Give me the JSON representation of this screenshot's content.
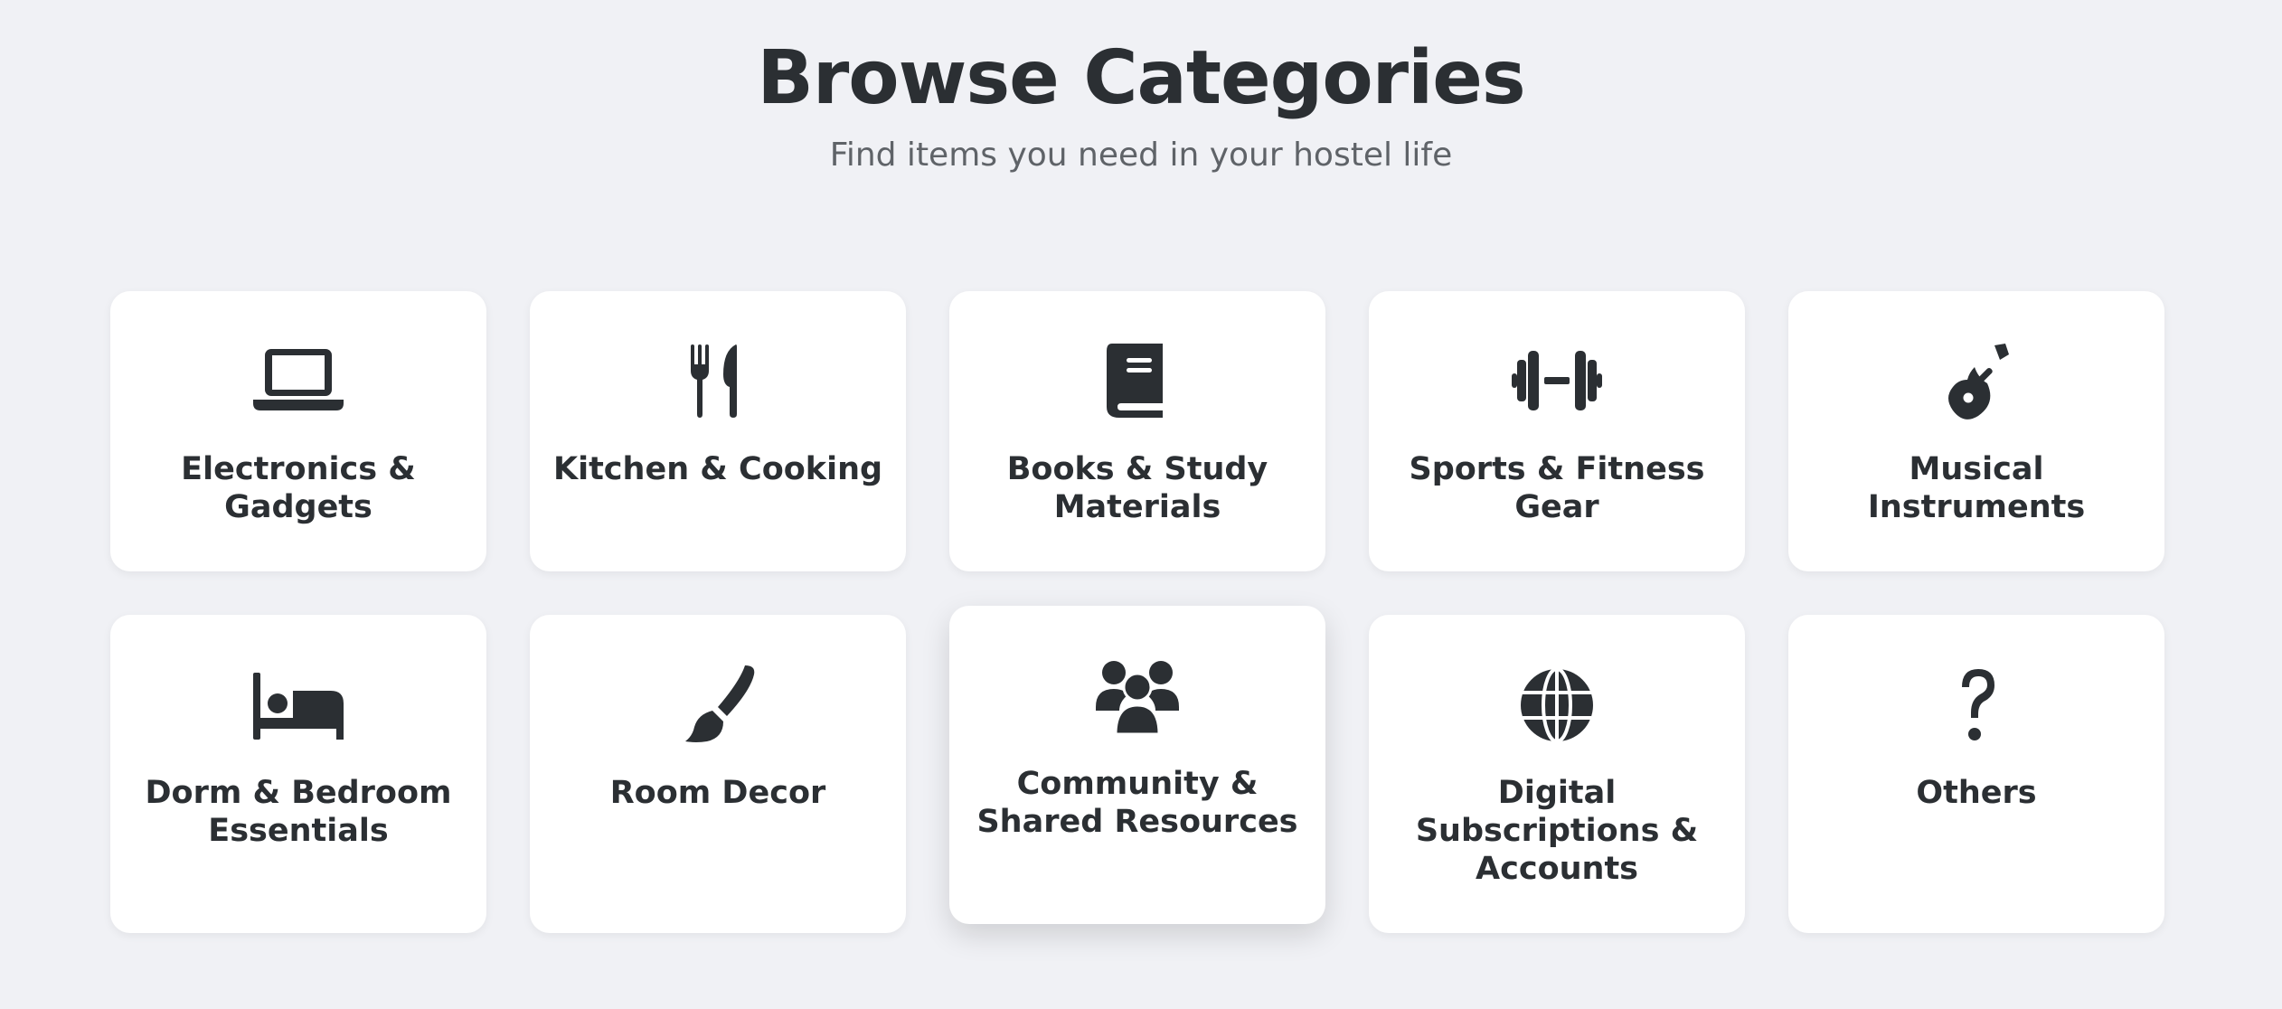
{
  "header": {
    "title": "Browse Categories",
    "subtitle": "Find items you need in your hostel life"
  },
  "colors": {
    "background": "#f0f1f5",
    "card": "#ffffff",
    "text": "#2b2f33",
    "muted_text": "#5f6368"
  },
  "categories": [
    {
      "label": "Electronics & Gadgets",
      "icon": "laptop-icon"
    },
    {
      "label": "Kitchen & Cooking",
      "icon": "utensils-icon"
    },
    {
      "label": "Books & Study Materials",
      "icon": "book-icon"
    },
    {
      "label": "Sports & Fitness Gear",
      "icon": "dumbbell-icon"
    },
    {
      "label": "Musical Instruments",
      "icon": "guitar-icon"
    },
    {
      "label": "Dorm & Bedroom Essentials",
      "icon": "bed-icon"
    },
    {
      "label": "Room Decor",
      "icon": "paintbrush-icon"
    },
    {
      "label": "Community & Shared Resources",
      "icon": "users-icon"
    },
    {
      "label": "Digital Subscriptions & Accounts",
      "icon": "globe-icon"
    },
    {
      "label": "Others",
      "icon": "question-icon"
    }
  ]
}
